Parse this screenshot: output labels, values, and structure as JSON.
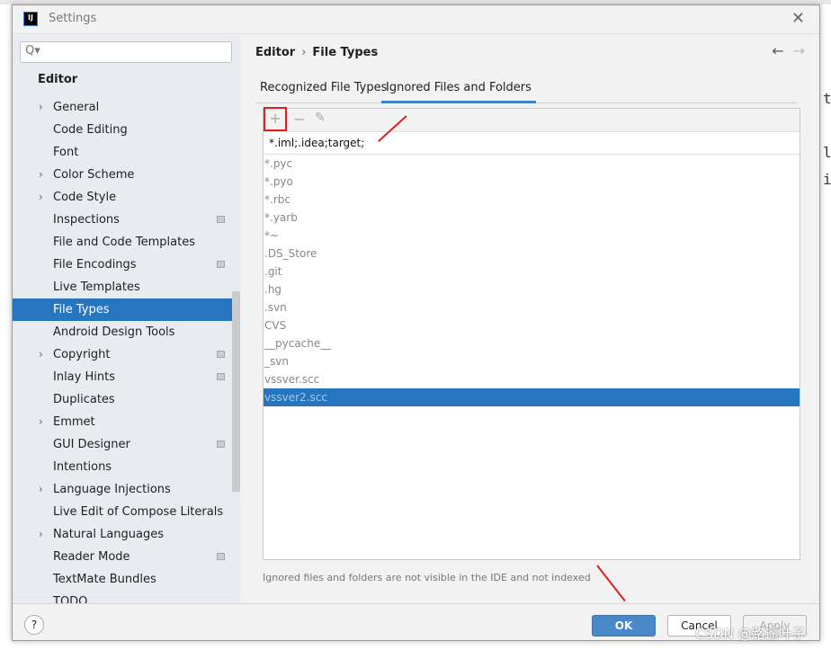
{
  "window": {
    "title": "Settings",
    "logo": "IJ"
  },
  "search": {
    "placeholder": "Q▾"
  },
  "sidebar": {
    "section": "Editor",
    "items": [
      {
        "label": "General",
        "chevron": true,
        "scope": false
      },
      {
        "label": "Code Editing",
        "chevron": false,
        "scope": false
      },
      {
        "label": "Font",
        "chevron": false,
        "scope": false
      },
      {
        "label": "Color Scheme",
        "chevron": true,
        "scope": false
      },
      {
        "label": "Code Style",
        "chevron": true,
        "scope": false
      },
      {
        "label": "Inspections",
        "chevron": false,
        "scope": true
      },
      {
        "label": "File and Code Templates",
        "chevron": false,
        "scope": false
      },
      {
        "label": "File Encodings",
        "chevron": false,
        "scope": true
      },
      {
        "label": "Live Templates",
        "chevron": false,
        "scope": false
      },
      {
        "label": "File Types",
        "chevron": false,
        "scope": false,
        "selected": true
      },
      {
        "label": "Android Design Tools",
        "chevron": false,
        "scope": false
      },
      {
        "label": "Copyright",
        "chevron": true,
        "scope": true
      },
      {
        "label": "Inlay Hints",
        "chevron": false,
        "scope": true
      },
      {
        "label": "Duplicates",
        "chevron": false,
        "scope": false
      },
      {
        "label": "Emmet",
        "chevron": true,
        "scope": false
      },
      {
        "label": "GUI Designer",
        "chevron": false,
        "scope": true
      },
      {
        "label": "Intentions",
        "chevron": false,
        "scope": false
      },
      {
        "label": "Language Injections",
        "chevron": true,
        "scope": false
      },
      {
        "label": "Live Edit of Compose Literals",
        "chevron": false,
        "scope": false
      },
      {
        "label": "Natural Languages",
        "chevron": true,
        "scope": false
      },
      {
        "label": "Reader Mode",
        "chevron": false,
        "scope": true
      },
      {
        "label": "TextMate Bundles",
        "chevron": false,
        "scope": false
      },
      {
        "label": "TODO",
        "chevron": false,
        "scope": false
      }
    ]
  },
  "breadcrumb": {
    "parent": "Editor",
    "separator": "›",
    "current": "File Types"
  },
  "nav": {
    "back": "←",
    "forward": "→"
  },
  "tabs": [
    "Recognized File Types",
    "Ignored Files and Folders"
  ],
  "toolbar": {
    "add": "+",
    "remove": "−",
    "edit": "✎"
  },
  "ignore_input": "*.iml;.idea;target;",
  "ignored_list": [
    "*.pyc",
    "*.pyo",
    "*.rbc",
    "*.yarb",
    "*~",
    ".DS_Store",
    ".git",
    ".hg",
    ".svn",
    "CVS",
    "__pycache__",
    "_svn",
    "vssver.scc",
    "vssver2.scc"
  ],
  "selected_index": 13,
  "hint": "Ignored files and folders are not visible in the IDE and not indexed",
  "footer": {
    "help": "?",
    "ok": "OK",
    "cancel": "Cancel",
    "apply": "Apply"
  },
  "watermark": "CSDN @路遥叶子",
  "accent": "#2675bf"
}
